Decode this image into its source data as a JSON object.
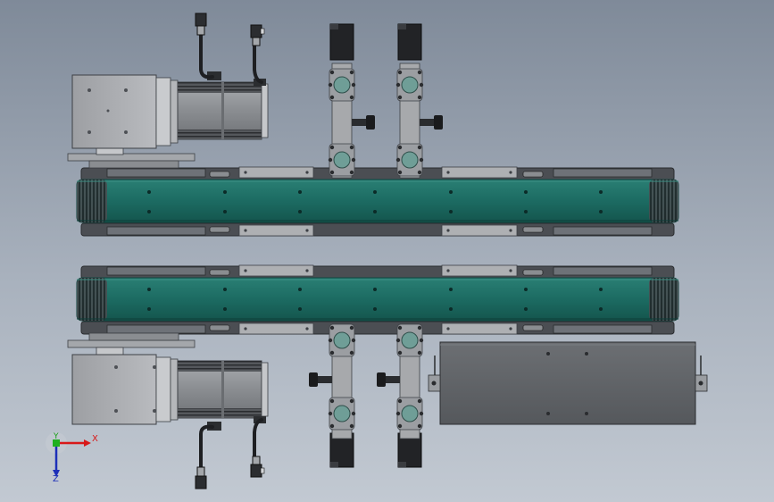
{
  "viewport": {
    "background_top": "#7f8a99",
    "background_bottom": "#c2c9d2"
  },
  "colors": {
    "belt": "#1c6b62",
    "belt_dark": "#0f4640",
    "frame": "#6e7278",
    "frame_dark": "#3d4045",
    "bracket": "#aeb0b3",
    "motor_body": "#8c8f93",
    "motor_ribs": "#2b2d30",
    "motor_flange": "#c5c7ca",
    "cable": "#1e1f22",
    "cylinder_body": "#a7a9ac",
    "cylinder_port": "#6f9e97",
    "cylinder_cap": "#222326",
    "control_box": "#5d6064"
  },
  "icons": {
    "triad": "coordinate-axes-icon"
  },
  "axes": {
    "x_label": "X",
    "y_label": "Y",
    "z_label": "Z",
    "x_color": "#d81818",
    "y_color": "#169e16",
    "z_color": "#1c2fb8"
  }
}
